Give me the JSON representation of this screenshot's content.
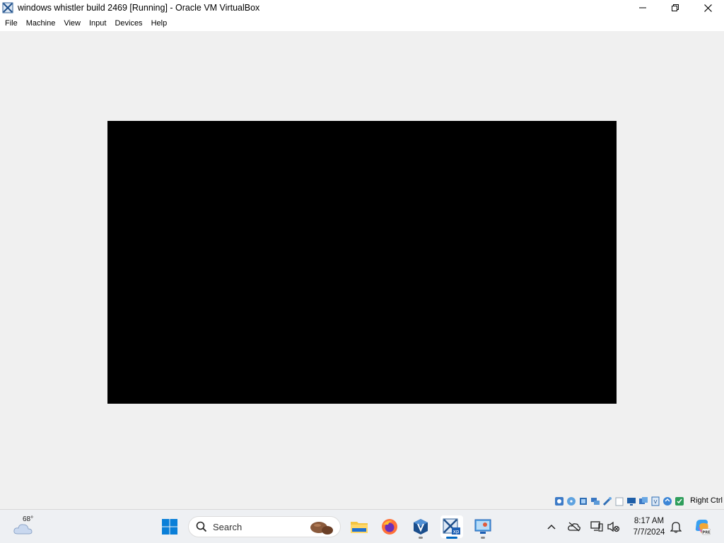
{
  "window": {
    "title": "windows whistler build 2469 [Running] - Oracle VM VirtualBox",
    "app_icon": "virtualbox-vm-icon",
    "controls": [
      "minimize-icon",
      "restore-icon",
      "close-icon"
    ]
  },
  "menubar": {
    "items": [
      "File",
      "Machine",
      "View",
      "Input",
      "Devices",
      "Help"
    ]
  },
  "vm_display": {
    "state": "black-screen",
    "background": "#000000"
  },
  "statusbar": {
    "icons": [
      "hard-disk-icon",
      "optical-drive-icon",
      "audio-icon",
      "network-icon",
      "usb-icon",
      "shared-folders-icon",
      "display-icon",
      "recording-icon",
      "cpu-icon",
      "mouse-integration-icon",
      "keyboard-icon"
    ],
    "host_key": "Right Ctrl"
  },
  "taskbar": {
    "weather": {
      "temperature": "68°",
      "icon": "cloudy-weather-icon"
    },
    "search": {
      "placeholder": "Search"
    },
    "pinned": [
      "windows-start-icon",
      "file-explorer-icon",
      "firefox-icon",
      "virtualbox-icon",
      "virtualbox-vm-xp-icon",
      "remote-desktop-icon"
    ],
    "tray": [
      "chevron-up-icon",
      "onedrive-offline-icon",
      "network-icon",
      "volume-muted-icon"
    ],
    "clock": {
      "time": "8:17 AM",
      "date": "7/7/2024"
    },
    "notification_icon": "bell-icon",
    "copilot_icon": "copilot-icon",
    "accent": "#0067c0"
  }
}
